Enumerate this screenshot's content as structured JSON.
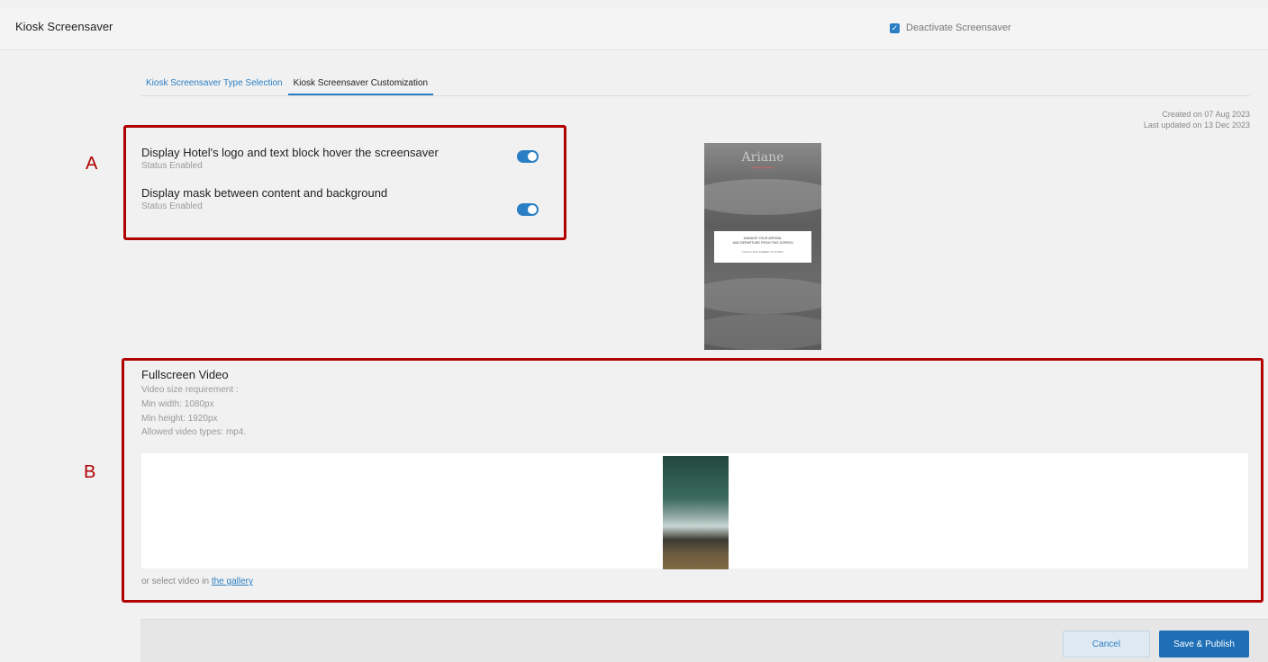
{
  "header": {
    "title": "Kiosk Screensaver",
    "deactivate_label": "Deactivate Screensaver",
    "deactivate_checked": true
  },
  "tabs": [
    {
      "label": "Kiosk Screensaver Type Selection",
      "active": false
    },
    {
      "label": "Kiosk Screensaver Customization",
      "active": true
    }
  ],
  "meta": {
    "created": "Created on 07 Aug 2023",
    "updated": "Last updated on 13 Dec 2023"
  },
  "options": [
    {
      "title": "Display Hotel's logo and text block hover the screensaver",
      "status": "Status Enabled",
      "enabled": true
    },
    {
      "title": "Display mask between content and background",
      "status": "Status Enabled",
      "enabled": true
    }
  ],
  "preview": {
    "logo_text": "Ariane",
    "card_line1": "MANAGE YOUR ARRIVAL",
    "card_line2": "AND DEPARTURE FROM THIS SCREEN",
    "card_line3": "TOUCH THE SCREEN TO START"
  },
  "video": {
    "title": "Fullscreen Video",
    "requirements": [
      "Video size requirement :",
      "Min width: 1080px",
      "Min height: 1920px",
      "Allowed video types: mp4."
    ],
    "gallery_prefix": "or select video in ",
    "gallery_link": "the gallery"
  },
  "annotations": {
    "a": "A",
    "b": "B"
  },
  "footer": {
    "cancel_label": "Cancel",
    "save_label": "Save & Publish"
  },
  "colors": {
    "accent": "#2a7fc4",
    "annotation": "#b00000",
    "primary_button": "#1f6fb7"
  }
}
